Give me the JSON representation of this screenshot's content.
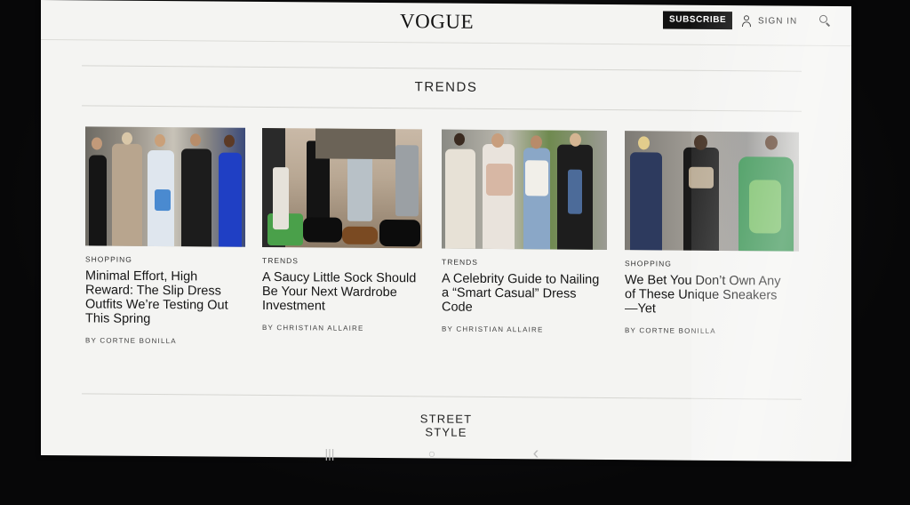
{
  "header": {
    "logo": "VOGUE",
    "subscribe_label": "SUBSCRIBE",
    "signin_label": "SIGN IN"
  },
  "sections": {
    "trends_title": "TRENDS",
    "street_style_line1": "STREET",
    "street_style_line2": "STYLE"
  },
  "articles": [
    {
      "tag": "SHOPPING",
      "headline": "Minimal Effort, High Reward: The Slip Dress Outfits We’re Testing Out This Spring",
      "byline": "BY CORTNE BONILLA"
    },
    {
      "tag": "TRENDS",
      "headline": "A Saucy Little Sock Should Be Your Next Wardrobe Investment",
      "byline": "BY CHRISTIAN ALLAIRE"
    },
    {
      "tag": "TRENDS",
      "headline": "A Celebrity Guide to Nailing a “Smart Casual” Dress Code",
      "byline": "BY CHRISTIAN ALLAIRE"
    },
    {
      "tag": "SHOPPING",
      "headline": "We Bet You Don’t Own Any of These Unique Sneakers—Yet",
      "byline": "BY CORTNE BONILLA"
    }
  ],
  "system_nav": {
    "recents_icon": "|||",
    "home_icon": "○",
    "back_icon": "‹"
  }
}
